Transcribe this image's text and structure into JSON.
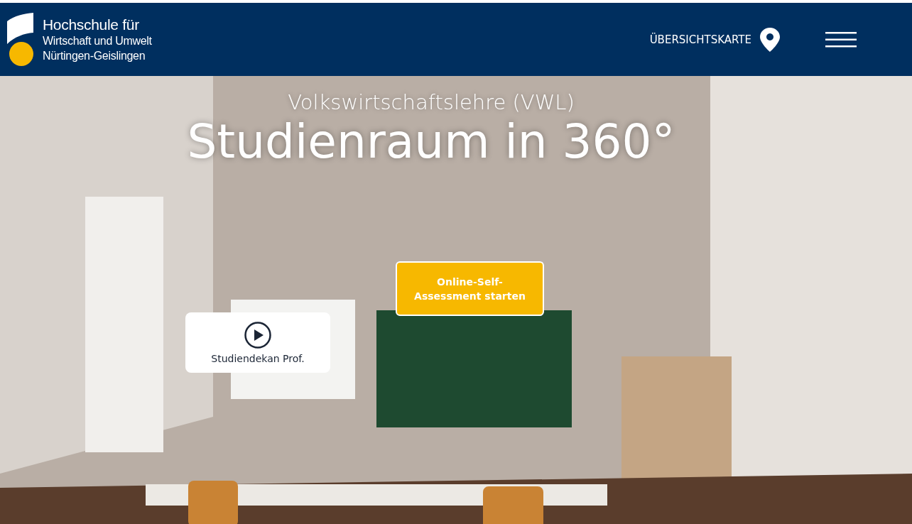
{
  "logo": {
    "lines": [
      "Hochschule für",
      "Wirtschaft und Umwelt",
      "Nürtingen-Geislingen"
    ]
  },
  "nav": {
    "map_link": "ÜBERSICHTSKARTE"
  },
  "hero": {
    "kind": "picture",
    "subtitle": "Volkswirtschaftslehre (VWL)",
    "title": "Studienraum in 360°",
    "assessment_button": "Online-Self-Assessment starten",
    "video_card": {
      "label": "Studiendekan Prof."
    }
  }
}
